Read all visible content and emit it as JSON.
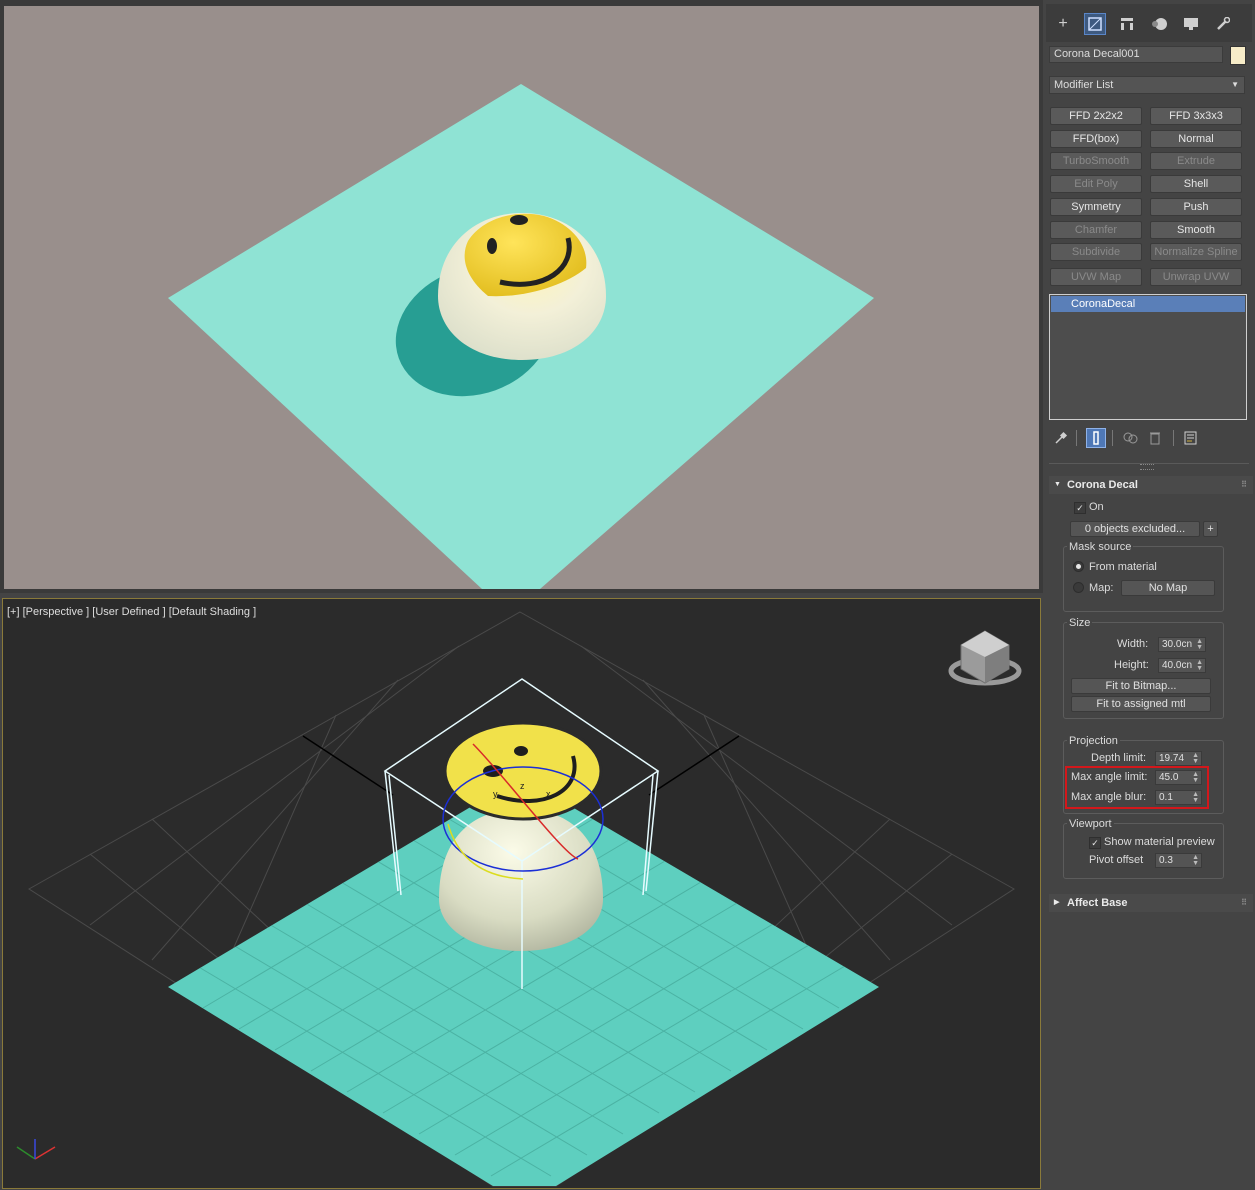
{
  "viewport": {
    "label": "[+] [Perspective ] [User Defined ] [Default Shading ]",
    "colors": {
      "render_bg": "#998f8c",
      "plane": "#8fe3d4",
      "viewport_bg": "#2b2b2b",
      "viewport_plane": "#5ecfbf",
      "smiley": "#f3d12b"
    }
  },
  "command_panel": {
    "tabs": [
      "create-icon",
      "modify-icon",
      "hierarchy-icon",
      "motion-icon",
      "display-icon",
      "utilities-icon"
    ],
    "object_name": "Corona Decal001",
    "object_color": "#f7ecc8",
    "modifier_list": "Modifier List",
    "modifier_buttons": [
      {
        "label": "FFD 2x2x2",
        "enabled": true
      },
      {
        "label": "FFD 3x3x3",
        "enabled": true
      },
      {
        "label": "FFD(box)",
        "enabled": true
      },
      {
        "label": "Normal",
        "enabled": true
      },
      {
        "label": "TurboSmooth",
        "enabled": false
      },
      {
        "label": "Extrude",
        "enabled": false
      },
      {
        "label": "Edit Poly",
        "enabled": false
      },
      {
        "label": "Shell",
        "enabled": true
      },
      {
        "label": "Symmetry",
        "enabled": true
      },
      {
        "label": "Push",
        "enabled": true
      },
      {
        "label": "Chamfer",
        "enabled": false
      },
      {
        "label": "Smooth",
        "enabled": true
      },
      {
        "label": "Subdivide",
        "enabled": false
      },
      {
        "label": "Normalize Spline",
        "enabled": false
      },
      {
        "label": "UVW Map",
        "enabled": false
      },
      {
        "label": "Unwrap UVW",
        "enabled": false
      }
    ],
    "stack": [
      "CoronaDecal"
    ],
    "stack_tools": [
      "pin-icon",
      "show-end-result-icon",
      "make-unique-icon",
      "remove-modifier-icon",
      "configure-sets-icon"
    ]
  },
  "corona_decal": {
    "title": "Corona Decal",
    "on_label": "On",
    "on_checked": true,
    "excluded_button": "0 objects excluded...",
    "plus": "+",
    "mask_source": {
      "title": "Mask source",
      "from_material": "From material",
      "map_label": "Map:",
      "map_button": "No Map",
      "selected": "From material"
    },
    "size": {
      "title": "Size",
      "width_label": "Width:",
      "width": "30.0cn",
      "height_label": "Height:",
      "height": "40.0cn",
      "fit_bitmap": "Fit to Bitmap...",
      "fit_mtl": "Fit to assigned mtl"
    },
    "projection": {
      "title": "Projection",
      "depth_label": "Depth limit:",
      "depth": "19.74",
      "max_angle_label": "Max angle limit:",
      "max_angle": "45.0",
      "max_blur_label": "Max angle blur:",
      "max_blur": "0.1"
    },
    "viewport": {
      "title": "Viewport",
      "show_preview": "Show material preview",
      "show_preview_checked": true,
      "pivot_label": "Pivot offset",
      "pivot": "0.3"
    }
  },
  "affect_base": {
    "title": "Affect Base"
  }
}
